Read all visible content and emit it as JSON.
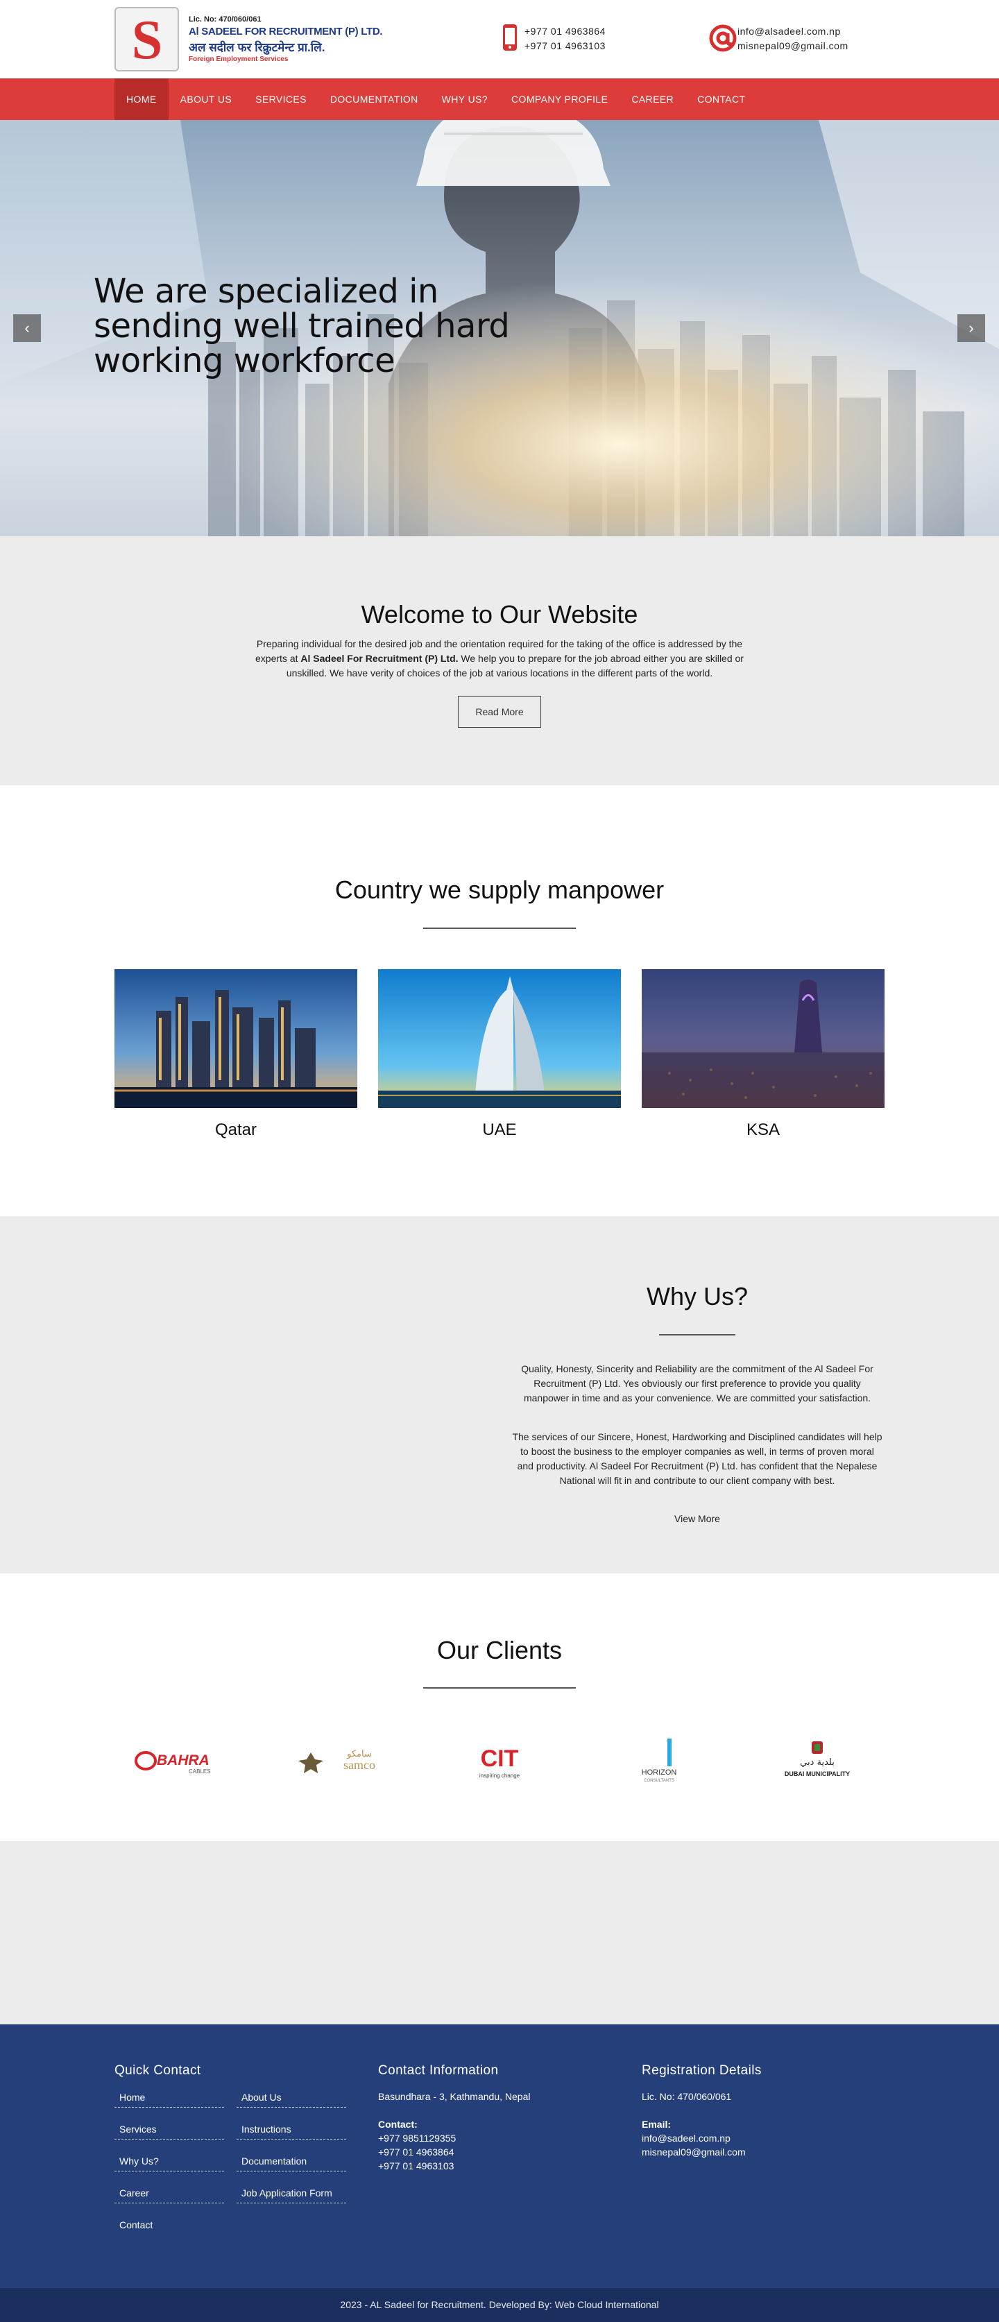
{
  "header": {
    "logo": {
      "license": "Lic. No: 470/060/061",
      "name": "Al SADEEL FOR RECRUITMENT (P) LTD.",
      "nepali": "अल सदील फर रिक्रुटमेन्ट प्रा.लि.",
      "tagline": "Foreign Employment Services",
      "letter": "S"
    },
    "phones": [
      "+977 01 4963864",
      "+977 01 4963103"
    ],
    "emails": [
      "info@alsadeel.com.np",
      "misnepal09@gmail.com"
    ]
  },
  "nav": {
    "items": [
      "HOME",
      "ABOUT US",
      "SERVICES",
      "DOCUMENTATION",
      "WHY US?",
      "COMPANY PROFILE",
      "CAREER",
      "CONTACT"
    ],
    "active": "HOME"
  },
  "hero": {
    "title": "We are specialized in sending well trained hard working workforce",
    "prev_icon": "‹",
    "next_icon": "›"
  },
  "welcome": {
    "title": "Welcome to Our Website",
    "text_before": "Preparing individual for the desired job and the orientation required for the taking of the office is addressed by the experts at ",
    "text_bold": "Al Sadeel For Recruitment (P) Ltd.",
    "text_after": " We help you to prepare for the job abroad either you are skilled or unskilled. We have verity of choices of the job at various locations in the different parts of the world.",
    "button": "Read More"
  },
  "countries": {
    "title": "Country we supply manpower",
    "items": [
      {
        "name": "Qatar"
      },
      {
        "name": "UAE"
      },
      {
        "name": "KSA"
      }
    ]
  },
  "why_us": {
    "title": "Why Us?",
    "p1": "Quality, Honesty, Sincerity and Reliability are the commitment of the Al Sadeel For Recruitment (P) Ltd. Yes obviously our first preference to provide you quality manpower in time and as your convenience. We are committed your satisfaction.",
    "p2": "The services of our Sincere, Honest, Hardworking and Disciplined candidates will help to boost the business to the employer companies as well, in terms of proven moral and productivity. Al Sadeel For Recruitment (P) Ltd. has confident that the Nepalese National will fit in and contribute to our client company with best.",
    "link": "View More"
  },
  "clients": {
    "title": "Our Clients",
    "logos": [
      {
        "text": "BAHRA",
        "sub": "CABLES"
      },
      {
        "text": "samco",
        "sub": "سامكو"
      },
      {
        "text": "CIT",
        "sub": "inspiring change"
      },
      {
        "text": "HORIZON",
        "sub": "CONSULTANTS"
      },
      {
        "text": "DUBAI MUNICIPALITY",
        "sub": "بلدية دبي"
      }
    ]
  },
  "footer": {
    "quick_contact": {
      "title": "Quick Contact",
      "links": [
        "Home",
        "About Us",
        "Services",
        "Instructions",
        "Why Us?",
        "Documentation",
        "Career",
        "Job Application Form",
        "Contact"
      ]
    },
    "contact_info": {
      "title": "Contact Information",
      "address": "Basundhara - 3, Kathmandu, Nepal",
      "contact_label": "Contact:",
      "phones": [
        "+977 9851129355",
        "+977 01 4963864",
        "+977 01 4963103"
      ]
    },
    "registration": {
      "title": "Registration Details",
      "license": "Lic. No: 470/060/061",
      "email_label": "Email:",
      "emails": [
        "info@sadeel.com.np",
        "misnepal09@gmail.com"
      ]
    },
    "copyright": "2023 - AL Sadeel for Recruitment. Developed By: Web Cloud International"
  },
  "colors": {
    "brand_red": "#dc3d3a",
    "nav_active": "#b72b28",
    "footer_blue": "#243f7a",
    "footer_bottom": "#1a2f5e",
    "section_gray": "#ececec"
  },
  "icons": {
    "phone": "phone-icon",
    "email": "at-sign-icon",
    "prev": "chevron-left-icon",
    "next": "chevron-right-icon"
  }
}
